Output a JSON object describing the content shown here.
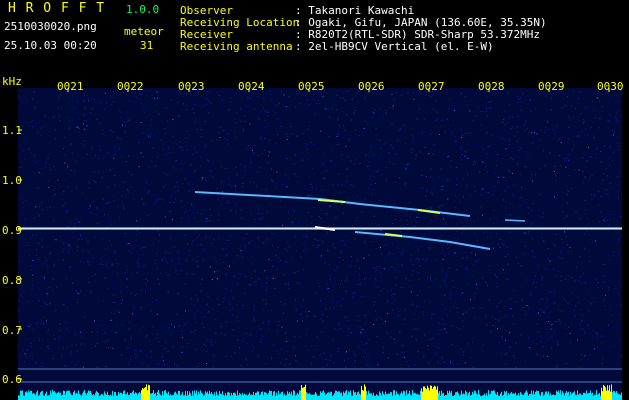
{
  "header": {
    "app_title": "H R O F F T",
    "version": "1.0.0",
    "filename": "2510030020.png",
    "meteor_label": "meteor",
    "datetime": "25.10.03 00:20",
    "meteor_count": "31",
    "observer_label": "Observer",
    "observer_value": ": Takanori Kawachi",
    "location_label": "Receiving Location",
    "location_value": ": Ogaki, Gifu, JAPAN (136.60E, 35.35N)",
    "receiver_label": "Receiver",
    "receiver_value": ": R820T2(RTL-SDR) SDR-Sharp 53.372MHz",
    "antenna_label": "Receiving antenna",
    "antenna_value": ": 2el-HB9CV Vertical (el. E-W)"
  },
  "axis": {
    "unit": "kHz",
    "freq_labels": [
      "1.1",
      "1.0",
      "0.9",
      "0.8",
      "0.7",
      "0.6"
    ],
    "time_labels": [
      "0021",
      "0022",
      "0023",
      "0024",
      "0025",
      "0026",
      "0027",
      "0028",
      "0029",
      "0030"
    ]
  },
  "colors": {
    "background": "#000000",
    "spectrum_bg": "#000a3a",
    "carrier": "#4da6ff",
    "echo": "#7fd4ff",
    "label_yellow": "#ffff00",
    "label_green": "#00ff66",
    "level_bar": "#00e5ff",
    "level_peak": "#ffff00"
  }
}
